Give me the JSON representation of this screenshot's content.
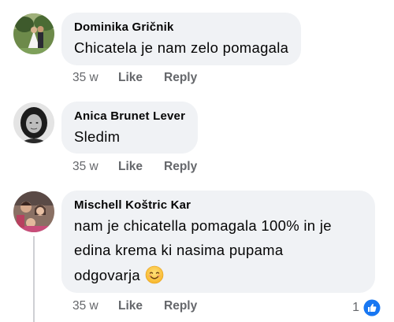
{
  "comments": [
    {
      "author": "Dominika Gričnik",
      "lines": [
        "Chicatela je nam zelo pomagala"
      ],
      "time": "35 w",
      "like_label": "Like",
      "reply_label": "Reply"
    },
    {
      "author": "Anica Brunet Lever",
      "lines": [
        "Sledim"
      ],
      "time": "35 w",
      "like_label": "Like",
      "reply_label": "Reply"
    },
    {
      "author": "Mischell Koštric Kar",
      "lines": [
        "nam je chicatella pomagala 100% in je",
        "edina krema ki nasima pupama",
        "odgovarja"
      ],
      "emoji": "smiling-face-emoji",
      "time": "35 w",
      "like_label": "Like",
      "reply_label": "Reply",
      "reaction_count": "1",
      "reaction_icon": "like-reaction-icon"
    }
  ],
  "colors": {
    "bubble": "#f0f2f5",
    "meta_text": "#65676b",
    "like_blue": "#1877f2"
  }
}
